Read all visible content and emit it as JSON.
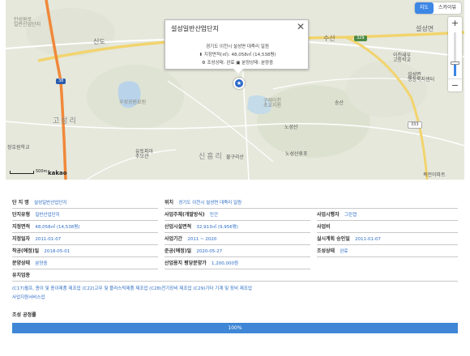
{
  "map": {
    "type_buttons": {
      "map": "지도",
      "skyview": "스카이뷰"
    },
    "zoom": {
      "in_label": "+",
      "out_label": "−",
      "level": 0.3
    },
    "popup": {
      "title": "설성일반산업단지",
      "close_label": "✕",
      "address": "경기도 이천시 설성면 대죽리 일원",
      "area": "지정면적(㎡): 48,058㎡ (14,538평)",
      "status": "조성상태: 완료",
      "sale_status": "분양상태: 분양중"
    },
    "labels": {
      "l1": "안성원로\n일반산업단지",
      "l2": "설성면",
      "l3": "이천새우\n고등학교",
      "l4": "설성면\n행정복지센터",
      "l5": "우성공원묘원",
      "l6": "유토피아\n추모관",
      "l7": "송산",
      "l8": "노성산",
      "l9": "노성산휴포",
      "l10": "물구리산",
      "l11": "구래이천\n초교지원",
      "l12": "신흥리",
      "l13": "고성리",
      "l14": "장호원학교",
      "l15": "복전이파트",
      "l16": "신도",
      "l17": "수산"
    },
    "shields": {
      "r38": "38",
      "r329": "329",
      "r333": "333"
    },
    "scale_text": "500m",
    "attribution": "kakao",
    "colors": {
      "accent": "#3c86e6",
      "value_text": "#2b6cc4",
      "marker": "#2c68c9"
    }
  },
  "info": {
    "row1": {
      "complex_name_label": "단 지 명",
      "complex_name": "설성일반산업단지",
      "location_label": "위치",
      "location": "경기도 이천시 설성면 대죽리 일원"
    },
    "row2": {
      "type_label": "단지유형",
      "type": "일반산업단지",
      "operator_type_label": "사업주체(개발방식)",
      "operator_type": "민간",
      "developer_label": "사업시행자",
      "developer": "그린캡"
    },
    "row3": {
      "designated_area_label": "지정면적",
      "designated_area": "48,058㎡ (14,538평)",
      "industrial_area_label": "산업시설면적",
      "industrial_area": "32,913㎡ (9,956평)",
      "cost_label": "사업비",
      "cost": ""
    },
    "row4": {
      "designated_date_label": "지정일자",
      "designated_date": "2011-01-07",
      "period_label": "사업기간",
      "period": "2011 ~ 2020",
      "plan_approval_label": "실시계획 승인일",
      "plan_approval": "2011-01-07"
    },
    "row5": {
      "start_date_label": "착공(예정)일",
      "start_date": "2018-05-01",
      "completion_label": "준공(예정)일",
      "completion": "2020-05-27",
      "build_status_label": "조성상태",
      "build_status": "완료"
    },
    "row6": {
      "sale_status_label": "분양상태",
      "sale_status": "분양중",
      "sale_price_label": "산업용지 평당분양가",
      "sale_price": "1,200,000원"
    },
    "row7": {
      "industries_label": "유치업종"
    },
    "industries_line1": "(C17)펄프, 종이 및 종이제품 제조업 (C22)고무 및 플라스틱제품 제조업 (C28)전기장비 제조업 (C29)기타 기계 및 장비 제조업",
    "industries_line2": "사업지원서비스업",
    "progress_title": "조성 공정률",
    "progress_value": 100,
    "progress_text": "100%"
  }
}
